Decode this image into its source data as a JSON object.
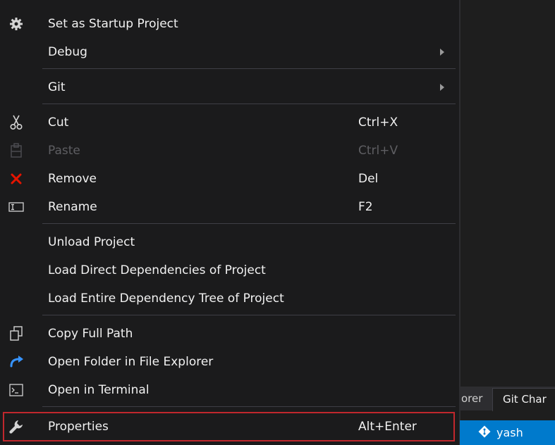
{
  "menu": {
    "items": [
      {
        "label": "Set as Startup Project",
        "shortcut": "",
        "icon": "gear-icon"
      },
      {
        "label": "Debug",
        "shortcut": "",
        "icon": ""
      },
      {
        "label": "Git",
        "shortcut": "",
        "icon": ""
      },
      {
        "label": "Cut",
        "shortcut": "Ctrl+X",
        "icon": "scissors-icon"
      },
      {
        "label": "Paste",
        "shortcut": "Ctrl+V",
        "icon": "paste-icon"
      },
      {
        "label": "Remove",
        "shortcut": "Del",
        "icon": "remove-icon"
      },
      {
        "label": "Rename",
        "shortcut": "F2",
        "icon": "rename-icon"
      },
      {
        "label": "Unload Project",
        "shortcut": "",
        "icon": ""
      },
      {
        "label": "Load Direct Dependencies of Project",
        "shortcut": "",
        "icon": ""
      },
      {
        "label": "Load Entire Dependency Tree of Project",
        "shortcut": "",
        "icon": ""
      },
      {
        "label": "Copy Full Path",
        "shortcut": "",
        "icon": "copy-icon"
      },
      {
        "label": "Open Folder in File Explorer",
        "shortcut": "",
        "icon": "folder-open-icon"
      },
      {
        "label": "Open in Terminal",
        "shortcut": "",
        "icon": "terminal-icon"
      },
      {
        "label": "Properties",
        "shortcut": "Alt+Enter",
        "icon": "wrench-icon"
      }
    ]
  },
  "tabs": {
    "explorer_partial": "orer",
    "git_changes_partial": "Git Char"
  },
  "status": {
    "branch": "yash"
  },
  "colors": {
    "accent": "#007acc",
    "remove": "#e51400",
    "highlight_border": "#c1272d"
  }
}
